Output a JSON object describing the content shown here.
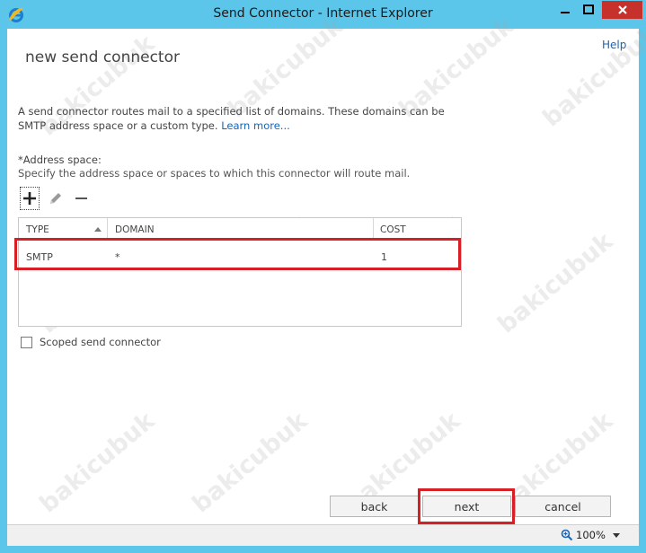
{
  "window": {
    "title": "Send Connector - Internet Explorer",
    "help": "Help"
  },
  "page": {
    "title": "new send connector",
    "description": "A send connector routes mail to a specified list of domains. These domains can be SMTP address space or a custom type.",
    "learn_more": "Learn more...",
    "address_space_label": "*Address space:",
    "address_space_hint": "Specify the address space or spaces to which this connector will route mail."
  },
  "grid": {
    "headers": {
      "type": "TYPE",
      "domain": "DOMAIN",
      "cost": "COST"
    },
    "rows": [
      {
        "type": "SMTP",
        "domain": "*",
        "cost": "1"
      }
    ]
  },
  "checkbox": {
    "label": "Scoped send connector",
    "checked": false
  },
  "buttons": {
    "back": "back",
    "next": "next",
    "cancel": "cancel"
  },
  "status": {
    "zoom": "100%"
  },
  "watermark": "bakicubuk",
  "colors": {
    "chrome": "#5bc6ea",
    "highlight": "#d71f26",
    "link": "#1a64b3",
    "close": "#c7312b"
  }
}
